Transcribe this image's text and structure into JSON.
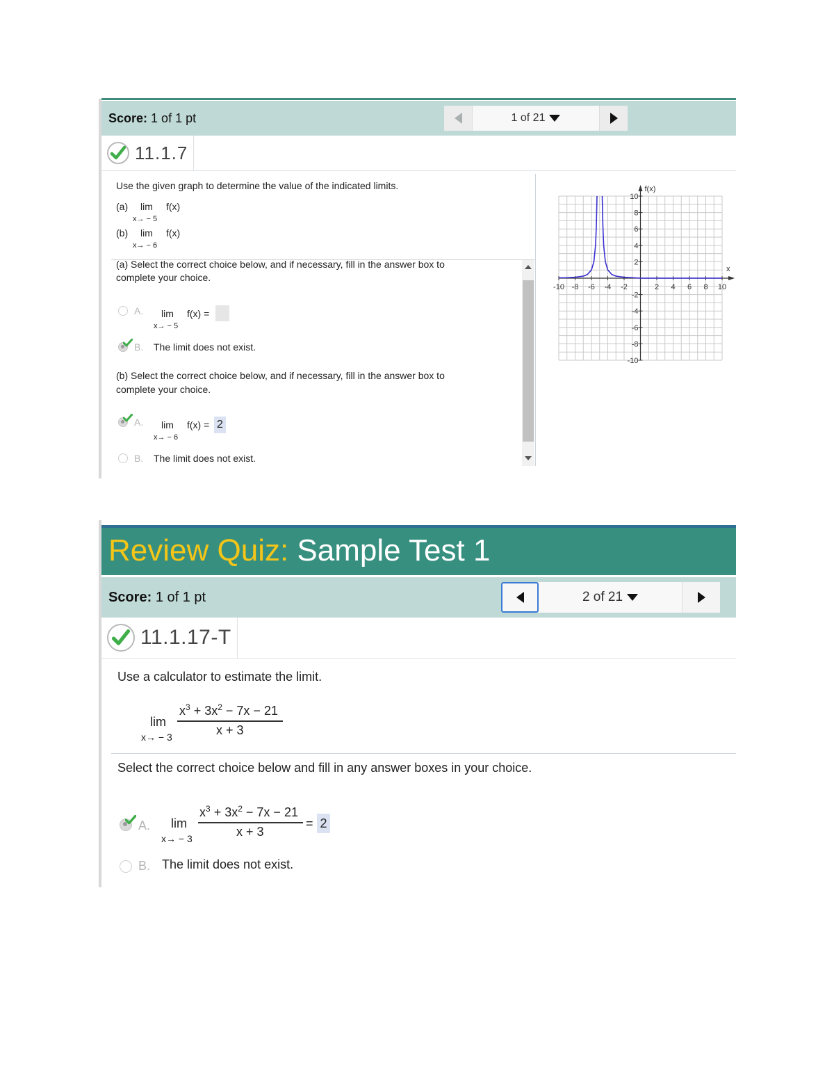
{
  "question1": {
    "score": {
      "label": "Score:",
      "value": "1 of 1 pt"
    },
    "nav": {
      "position": "1 of 21",
      "prev_enabled": false
    },
    "question_id": "11.1.7",
    "status": "correct",
    "prompt": "Use the given graph to determine the value of the indicated limits.",
    "limits": [
      {
        "label": "(a)",
        "lim": "lim",
        "func": "f(x)",
        "approach": "x→ − 5"
      },
      {
        "label": "(b)",
        "lim": "lim",
        "func": "f(x)",
        "approach": "x→ − 6"
      }
    ],
    "part_a": {
      "instruction_line1": "(a) Select the correct choice below, and if necessary, fill in the answer box to",
      "instruction_line2": "complete your choice.",
      "choices": [
        {
          "letter": "A.",
          "lim": "lim",
          "expr": "f(x) =",
          "approach": "x→ − 5",
          "answer": "",
          "selected": false
        },
        {
          "letter": "B.",
          "text": "The limit does not exist.",
          "selected": true
        }
      ]
    },
    "part_b": {
      "instruction_line1": "(b) Select the correct choice below, and if necessary, fill in the answer box to",
      "instruction_line2": "complete your choice.",
      "choices": [
        {
          "letter": "A.",
          "lim": "lim",
          "expr": "f(x) =",
          "approach": "x→ − 6",
          "answer": "2",
          "selected": true
        },
        {
          "letter": "B.",
          "text": "The limit does not exist.",
          "selected": false
        }
      ]
    }
  },
  "question2": {
    "quiz_title_prefix": "Review Quiz:",
    "quiz_title": "Sample Test 1",
    "score": {
      "label": "Score:",
      "value": "1 of 1 pt"
    },
    "nav": {
      "position": "2 of 21",
      "prev_enabled": true
    },
    "question_id": "11.1.17-T",
    "status": "correct",
    "prompt": "Use a calculator to estimate the limit.",
    "limit": {
      "lim": "lim",
      "approach": "x→ − 3",
      "numerator_html": "x³ + 3x² − 7x − 21",
      "denominator": "x + 3"
    },
    "instruction": "Select the correct choice below and fill in any answer boxes in your choice.",
    "choices": [
      {
        "letter": "A.",
        "lim": "lim",
        "approach": "x→ − 3",
        "equals": "=",
        "answer": "2",
        "selected": true
      },
      {
        "letter": "B.",
        "text": "The limit does not exist.",
        "selected": false
      }
    ]
  },
  "colors": {
    "score_bar": "#bfdad6",
    "title_bar": "#378f7f",
    "title_prefix": "#f5c518",
    "check_green": "#3fae49",
    "curve": "#3b2fd0"
  },
  "chart_data": {
    "type": "line",
    "title": "",
    "xlabel": "x",
    "ylabel": "f(x)",
    "xlim": [
      -10,
      10
    ],
    "ylim": [
      -10,
      10
    ],
    "grid": true,
    "x_ticks": [
      -10,
      -8,
      -6,
      -4,
      -2,
      2,
      4,
      6,
      8,
      10
    ],
    "y_ticks": [
      10,
      8,
      6,
      4,
      2,
      -2,
      -4,
      -6,
      -8,
      -10
    ],
    "vertical_asymptote": -5,
    "series": [
      {
        "name": "f(x) left branch",
        "points": [
          [
            -10,
            0.04
          ],
          [
            -9,
            0.06
          ],
          [
            -8,
            0.11
          ],
          [
            -7,
            0.25
          ],
          [
            -6.5,
            0.44
          ],
          [
            -6,
            1.0
          ],
          [
            -5.7,
            2.0
          ],
          [
            -5.5,
            4.0
          ],
          [
            -5.4,
            6.25
          ],
          [
            -5.32,
            10
          ]
        ]
      },
      {
        "name": "f(x) right branch",
        "points": [
          [
            -4.68,
            10
          ],
          [
            -4.6,
            6.25
          ],
          [
            -4.5,
            4.0
          ],
          [
            -4.3,
            2.0
          ],
          [
            -4,
            1.0
          ],
          [
            -3.5,
            0.44
          ],
          [
            -3,
            0.25
          ],
          [
            -2,
            0.11
          ],
          [
            -1,
            0.06
          ],
          [
            0,
            0.0
          ],
          [
            10,
            0.0
          ]
        ]
      }
    ]
  }
}
